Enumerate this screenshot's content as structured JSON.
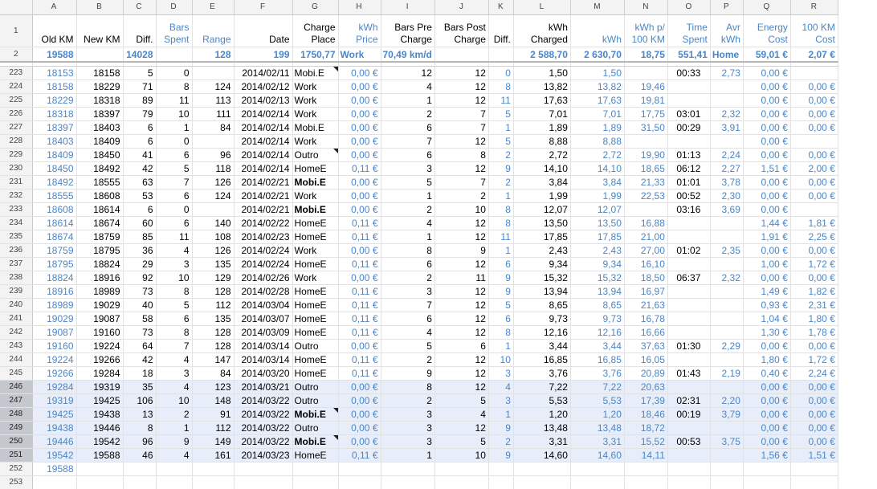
{
  "columns": [
    "",
    "A",
    "B",
    "C",
    "D",
    "E",
    "F",
    "G",
    "H",
    "I",
    "J",
    "K",
    "L",
    "M",
    "N",
    "O",
    "P",
    "Q",
    "R"
  ],
  "header_row_num": "1",
  "headers": [
    "Old KM",
    "New KM",
    "Diff.",
    "Bars\nSpent",
    "Range",
    "Date",
    "Charge\nPlace",
    "kWh\nPrice",
    "Bars Pre\nCharge",
    "Bars Post\nCharge",
    "Diff.",
    "kWh\nCharged",
    "kWh",
    "kWh p/\n100 KM",
    "Time\nSpent",
    "Avr\nkWh",
    "Energy\nCost",
    "100 KM\nCost"
  ],
  "summary_row_num": "2",
  "summary": [
    "19588",
    "",
    "14028",
    "",
    "128",
    "199",
    "1750,77",
    "Work",
    "70,49 km/d",
    "",
    "",
    "2 588,70",
    "2 630,70",
    "18,75",
    "551,41",
    "Home",
    "59,01 €",
    "2,07 €"
  ],
  "rows": [
    {
      "n": "223",
      "c": [
        "18153",
        "18158",
        "5",
        "0",
        "",
        "2014/02/11",
        "Mobi.E",
        "0,00 €",
        "12",
        "12",
        "0",
        "1,50",
        "1,50",
        "",
        "00:33",
        "2,73",
        "0,00 €",
        ""
      ],
      "flag": true,
      "boldG": false,
      "sel": false
    },
    {
      "n": "224",
      "c": [
        "18158",
        "18229",
        "71",
        "8",
        "124",
        "2014/02/12",
        "Work",
        "0,00 €",
        "4",
        "12",
        "8",
        "13,82",
        "13,82",
        "19,46",
        "",
        "",
        "0,00 €",
        "0,00 €"
      ],
      "flag": false,
      "boldG": false,
      "sel": false
    },
    {
      "n": "225",
      "c": [
        "18229",
        "18318",
        "89",
        "11",
        "113",
        "2014/02/13",
        "Work",
        "0,00 €",
        "1",
        "12",
        "11",
        "17,63",
        "17,63",
        "19,81",
        "",
        "",
        "0,00 €",
        "0,00 €"
      ],
      "flag": false,
      "boldG": false,
      "sel": false
    },
    {
      "n": "226",
      "c": [
        "18318",
        "18397",
        "79",
        "10",
        "111",
        "2014/02/14",
        "Work",
        "0,00 €",
        "2",
        "7",
        "5",
        "7,01",
        "7,01",
        "17,75",
        "03:01",
        "2,32",
        "0,00 €",
        "0,00 €"
      ],
      "flag": false,
      "boldG": false,
      "sel": false
    },
    {
      "n": "227",
      "c": [
        "18397",
        "18403",
        "6",
        "1",
        "84",
        "2014/02/14",
        "Mobi.E",
        "0,00 €",
        "6",
        "7",
        "1",
        "1,89",
        "1,89",
        "31,50",
        "00:29",
        "3,91",
        "0,00 €",
        "0,00 €"
      ],
      "flag": false,
      "boldG": false,
      "sel": false
    },
    {
      "n": "228",
      "c": [
        "18403",
        "18409",
        "6",
        "0",
        "",
        "2014/02/14",
        "Work",
        "0,00 €",
        "7",
        "12",
        "5",
        "8,88",
        "8,88",
        "",
        "",
        "",
        "0,00 €",
        ""
      ],
      "flag": false,
      "boldG": false,
      "sel": false
    },
    {
      "n": "229",
      "c": [
        "18409",
        "18450",
        "41",
        "6",
        "96",
        "2014/02/14",
        "Outro",
        "0,00 €",
        "6",
        "8",
        "2",
        "2,72",
        "2,72",
        "19,90",
        "01:13",
        "2,24",
        "0,00 €",
        "0,00 €"
      ],
      "flag": true,
      "boldG": false,
      "sel": false
    },
    {
      "n": "230",
      "c": [
        "18450",
        "18492",
        "42",
        "5",
        "118",
        "2014/02/14",
        "HomeE",
        "0,11 €",
        "3",
        "12",
        "9",
        "14,10",
        "14,10",
        "18,65",
        "06:12",
        "2,27",
        "1,51 €",
        "2,00 €"
      ],
      "flag": false,
      "boldG": false,
      "sel": false
    },
    {
      "n": "231",
      "c": [
        "18492",
        "18555",
        "63",
        "7",
        "126",
        "2014/02/21",
        "Mobi.E",
        "0,00 €",
        "5",
        "7",
        "2",
        "3,84",
        "3,84",
        "21,33",
        "01:01",
        "3,78",
        "0,00 €",
        "0,00 €"
      ],
      "flag": false,
      "boldG": true,
      "sel": false
    },
    {
      "n": "232",
      "c": [
        "18555",
        "18608",
        "53",
        "6",
        "124",
        "2014/02/21",
        "Work",
        "0,00 €",
        "1",
        "2",
        "1",
        "1,99",
        "1,99",
        "22,53",
        "00:52",
        "2,30",
        "0,00 €",
        "0,00 €"
      ],
      "flag": false,
      "boldG": false,
      "sel": false
    },
    {
      "n": "233",
      "c": [
        "18608",
        "18614",
        "6",
        "0",
        "",
        "2014/02/21",
        "Mobi.E",
        "0,00 €",
        "2",
        "10",
        "8",
        "12,07",
        "12,07",
        "",
        "03:16",
        "3,69",
        "0,00 €",
        ""
      ],
      "flag": false,
      "boldG": true,
      "sel": false
    },
    {
      "n": "234",
      "c": [
        "18614",
        "18674",
        "60",
        "6",
        "140",
        "2014/02/22",
        "HomeE",
        "0,11 €",
        "4",
        "12",
        "8",
        "13,50",
        "13,50",
        "16,88",
        "",
        "",
        "1,44 €",
        "1,81 €"
      ],
      "flag": false,
      "boldG": false,
      "sel": false
    },
    {
      "n": "235",
      "c": [
        "18674",
        "18759",
        "85",
        "11",
        "108",
        "2014/02/23",
        "HomeE",
        "0,11 €",
        "1",
        "12",
        "11",
        "17,85",
        "17,85",
        "21,00",
        "",
        "",
        "1,91 €",
        "2,25 €"
      ],
      "flag": false,
      "boldG": false,
      "sel": false
    },
    {
      "n": "236",
      "c": [
        "18759",
        "18795",
        "36",
        "4",
        "126",
        "2014/02/24",
        "Work",
        "0,00 €",
        "8",
        "9",
        "1",
        "2,43",
        "2,43",
        "27,00",
        "01:02",
        "2,35",
        "0,00 €",
        "0,00 €"
      ],
      "flag": false,
      "boldG": false,
      "sel": false
    },
    {
      "n": "237",
      "c": [
        "18795",
        "18824",
        "29",
        "3",
        "135",
        "2014/02/24",
        "HomeE",
        "0,11 €",
        "6",
        "12",
        "6",
        "9,34",
        "9,34",
        "16,10",
        "",
        "",
        "1,00 €",
        "1,72 €"
      ],
      "flag": false,
      "boldG": false,
      "sel": false
    },
    {
      "n": "238",
      "c": [
        "18824",
        "18916",
        "92",
        "10",
        "129",
        "2014/02/26",
        "Work",
        "0,00 €",
        "2",
        "11",
        "9",
        "15,32",
        "15,32",
        "18,50",
        "06:37",
        "2,32",
        "0,00 €",
        "0,00 €"
      ],
      "flag": false,
      "boldG": false,
      "sel": false
    },
    {
      "n": "239",
      "c": [
        "18916",
        "18989",
        "73",
        "8",
        "128",
        "2014/02/28",
        "HomeE",
        "0,11 €",
        "3",
        "12",
        "9",
        "13,94",
        "13,94",
        "16,97",
        "",
        "",
        "1,49 €",
        "1,82 €"
      ],
      "flag": false,
      "boldG": false,
      "sel": false
    },
    {
      "n": "240",
      "c": [
        "18989",
        "19029",
        "40",
        "5",
        "112",
        "2014/03/04",
        "HomeE",
        "0,11 €",
        "7",
        "12",
        "5",
        "8,65",
        "8,65",
        "21,63",
        "",
        "",
        "0,93 €",
        "2,31 €"
      ],
      "flag": false,
      "boldG": false,
      "sel": false
    },
    {
      "n": "241",
      "c": [
        "19029",
        "19087",
        "58",
        "6",
        "135",
        "2014/03/07",
        "HomeE",
        "0,11 €",
        "6",
        "12",
        "6",
        "9,73",
        "9,73",
        "16,78",
        "",
        "",
        "1,04 €",
        "1,80 €"
      ],
      "flag": false,
      "boldG": false,
      "sel": false
    },
    {
      "n": "242",
      "c": [
        "19087",
        "19160",
        "73",
        "8",
        "128",
        "2014/03/09",
        "HomeE",
        "0,11 €",
        "4",
        "12",
        "8",
        "12,16",
        "12,16",
        "16,66",
        "",
        "",
        "1,30 €",
        "1,78 €"
      ],
      "flag": false,
      "boldG": false,
      "sel": false
    },
    {
      "n": "243",
      "c": [
        "19160",
        "19224",
        "64",
        "7",
        "128",
        "2014/03/14",
        "Outro",
        "0,00 €",
        "5",
        "6",
        "1",
        "3,44",
        "3,44",
        "37,63",
        "01:30",
        "2,29",
        "0,00 €",
        "0,00 €"
      ],
      "flag": false,
      "boldG": false,
      "sel": false
    },
    {
      "n": "244",
      "c": [
        "19224",
        "19266",
        "42",
        "4",
        "147",
        "2014/03/14",
        "HomeE",
        "0,11 €",
        "2",
        "12",
        "10",
        "16,85",
        "16,85",
        "16,05",
        "",
        "",
        "1,80 €",
        "1,72 €"
      ],
      "flag": false,
      "boldG": false,
      "sel": false
    },
    {
      "n": "245",
      "c": [
        "19266",
        "19284",
        "18",
        "3",
        "84",
        "2014/03/20",
        "HomeE",
        "0,11 €",
        "9",
        "12",
        "3",
        "3,76",
        "3,76",
        "20,89",
        "01:43",
        "2,19",
        "0,40 €",
        "2,24 €"
      ],
      "flag": false,
      "boldG": false,
      "sel": false
    },
    {
      "n": "246",
      "c": [
        "19284",
        "19319",
        "35",
        "4",
        "123",
        "2014/03/21",
        "Outro",
        "0,00 €",
        "8",
        "12",
        "4",
        "7,22",
        "7,22",
        "20,63",
        "",
        "",
        "0,00 €",
        "0,00 €"
      ],
      "flag": false,
      "boldG": false,
      "sel": true
    },
    {
      "n": "247",
      "c": [
        "19319",
        "19425",
        "106",
        "10",
        "148",
        "2014/03/22",
        "Outro",
        "0,00 €",
        "2",
        "5",
        "3",
        "5,53",
        "5,53",
        "17,39",
        "02:31",
        "2,20",
        "0,00 €",
        "0,00 €"
      ],
      "flag": false,
      "boldG": false,
      "sel": true
    },
    {
      "n": "248",
      "c": [
        "19425",
        "19438",
        "13",
        "2",
        "91",
        "2014/03/22",
        "Mobi.E",
        "0,00 €",
        "3",
        "4",
        "1",
        "1,20",
        "1,20",
        "18,46",
        "00:19",
        "3,79",
        "0,00 €",
        "0,00 €"
      ],
      "flag": true,
      "boldG": true,
      "sel": true
    },
    {
      "n": "249",
      "c": [
        "19438",
        "19446",
        "8",
        "1",
        "112",
        "2014/03/22",
        "Outro",
        "0,00 €",
        "3",
        "12",
        "9",
        "13,48",
        "13,48",
        "18,72",
        "",
        "",
        "0,00 €",
        "0,00 €"
      ],
      "flag": false,
      "boldG": false,
      "sel": true
    },
    {
      "n": "250",
      "c": [
        "19446",
        "19542",
        "96",
        "9",
        "149",
        "2014/03/22",
        "Mobi.E",
        "0,00 €",
        "3",
        "5",
        "2",
        "3,31",
        "3,31",
        "15,52",
        "00:53",
        "3,75",
        "0,00 €",
        "0,00 €"
      ],
      "flag": true,
      "boldG": true,
      "sel": true
    },
    {
      "n": "251",
      "c": [
        "19542",
        "19588",
        "46",
        "4",
        "161",
        "2014/03/23",
        "HomeE",
        "0,11 €",
        "1",
        "10",
        "9",
        "14,60",
        "14,60",
        "14,11",
        "",
        "",
        "1,56 €",
        "1,51 €"
      ],
      "flag": false,
      "boldG": false,
      "sel": true
    },
    {
      "n": "252",
      "c": [
        "19588",
        "",
        "",
        "",
        "",
        "",
        "",
        "",
        "",
        "",
        "",
        "",
        "",
        "",
        "",
        "",
        "",
        ""
      ],
      "flag": false,
      "boldG": false,
      "sel": false
    },
    {
      "n": "253",
      "c": [
        "",
        "",
        "",
        "",
        "",
        "",
        "",
        "",
        "",
        "",
        "",
        "",
        "",
        "",
        "",
        "",
        "",
        ""
      ],
      "flag": false,
      "boldG": false,
      "sel": false
    }
  ]
}
